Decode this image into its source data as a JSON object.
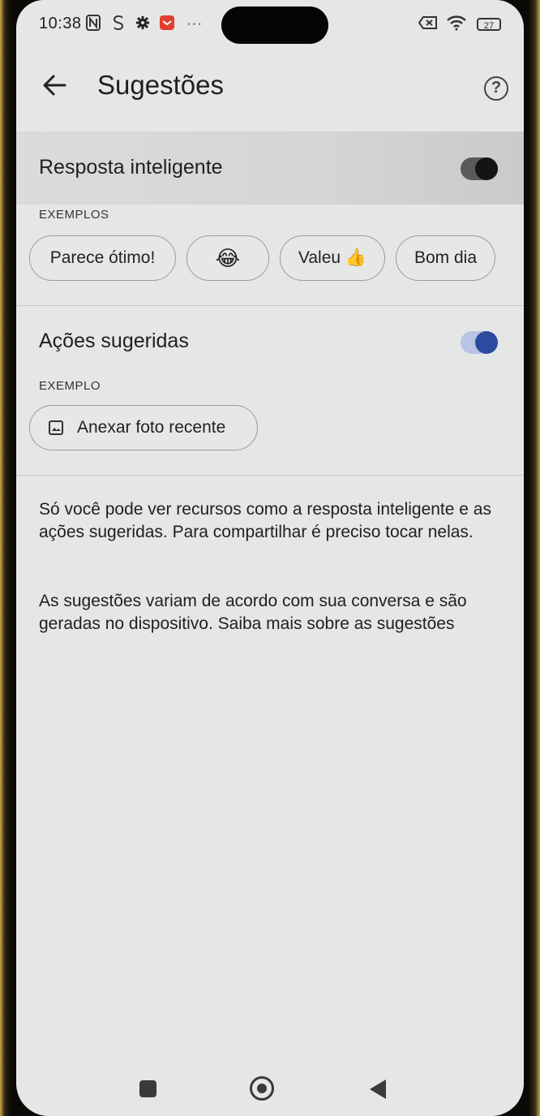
{
  "status_bar": {
    "time": "10:38",
    "icons": [
      "nfc-icon",
      "s-app-icon",
      "gear-icon",
      "app-notification-icon",
      "more-icon"
    ],
    "more": "···",
    "battery": "27"
  },
  "app_bar": {
    "title": "Sugestões",
    "back_icon": "arrow-left-icon",
    "help_icon": "help-circle-icon",
    "help_glyph": "?"
  },
  "smart_reply": {
    "label": "Resposta inteligente",
    "enabled": true,
    "examples_caption": "EXEMPLOS",
    "chips": [
      "Parece ótimo!",
      "😂",
      "Valeu 👍",
      "Bom dia"
    ]
  },
  "suggested_actions": {
    "label": "Ações sugeridas",
    "enabled": true,
    "example_caption": "EXEMPLO",
    "chip_label": "Anexar foto recente",
    "chip_icon": "image-icon"
  },
  "info": {
    "paragraph1": "Só você pode ver recursos como a resposta inteligente e as ações sugeridas. Para compartilhar é preciso tocar nelas.",
    "paragraph2": "As sugestões variam de acordo com sua conversa e são geradas no dispositivo. Saiba mais sobre as sugestões"
  },
  "nav_bar": {
    "icons": [
      "recents-square-icon",
      "home-circle-icon",
      "back-triangle-icon"
    ]
  },
  "colors": {
    "background": "#e5e7e6",
    "toggle_on_knob": "#2b4aa0",
    "toggle_on_track": "#b9c4e6",
    "toggle_dark_knob": "#1a1a1a",
    "toggle_dark_track": "#5a5a5a"
  }
}
